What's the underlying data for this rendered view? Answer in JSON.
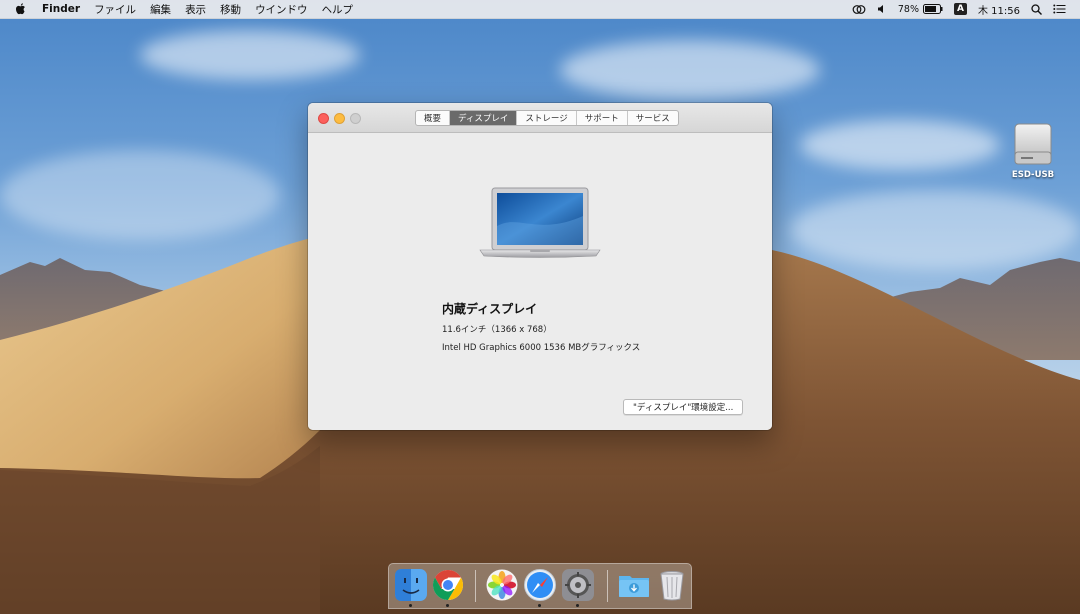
{
  "menubar": {
    "app_name": "Finder",
    "menus": [
      "ファイル",
      "編集",
      "表示",
      "移動",
      "ウインドウ",
      "ヘルプ"
    ],
    "battery_percent": "78%",
    "input_method": "A",
    "clock": "木 11:56"
  },
  "window": {
    "tabs": [
      {
        "label": "概要",
        "active": false
      },
      {
        "label": "ディスプレイ",
        "active": true
      },
      {
        "label": "ストレージ",
        "active": false
      },
      {
        "label": "サポート",
        "active": false
      },
      {
        "label": "サービス",
        "active": false
      }
    ],
    "display": {
      "name": "内蔵ディスプレイ",
      "size": "11.6インチ（1366 x 768）",
      "graphics": "Intel HD Graphics 6000 1536 MBグラフィックス"
    },
    "prefs_button_label": "\"ディスプレイ\"環境設定..."
  },
  "desktop": {
    "drive_label": "ESD-USB"
  },
  "dock": {
    "items": [
      {
        "name": "finder-icon",
        "running": true
      },
      {
        "name": "chrome-icon",
        "running": true
      },
      {
        "name": "photos-icon",
        "running": false
      },
      {
        "name": "safari-icon",
        "running": true
      },
      {
        "name": "system-preferences-icon",
        "running": true
      },
      {
        "name": "downloads-folder-icon",
        "running": false
      },
      {
        "name": "trash-icon",
        "running": false
      }
    ]
  },
  "colors": {
    "accent_active_tab": "#6a6a6a",
    "close": "#fc605c",
    "minimize": "#fdbc40",
    "zoom_disabled": "#cfcfcf"
  }
}
